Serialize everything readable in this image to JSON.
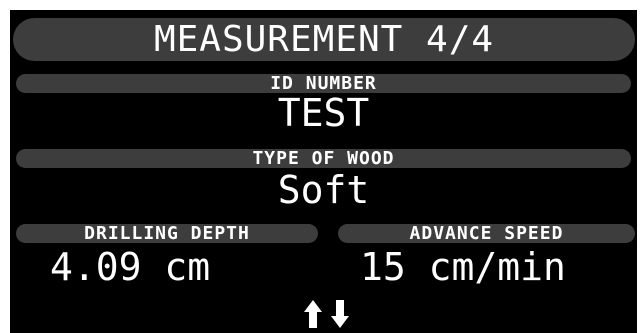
{
  "title": "MEASUREMENT 4/4",
  "id_section": {
    "label": "ID NUMBER",
    "value": "TEST"
  },
  "wood_section": {
    "label": "TYPE OF WOOD",
    "value": "Soft"
  },
  "depth_section": {
    "label": "DRILLING DEPTH",
    "value": "4.09 cm"
  },
  "speed_section": {
    "label": "ADVANCE SPEED",
    "value": "15 cm/min"
  },
  "navigation": {
    "up_icon": "arrow-up-icon",
    "down_icon": "arrow-down-icon"
  },
  "colors": {
    "background": "#000000",
    "pill": "#3d3d3d",
    "text": "#ffffff"
  }
}
